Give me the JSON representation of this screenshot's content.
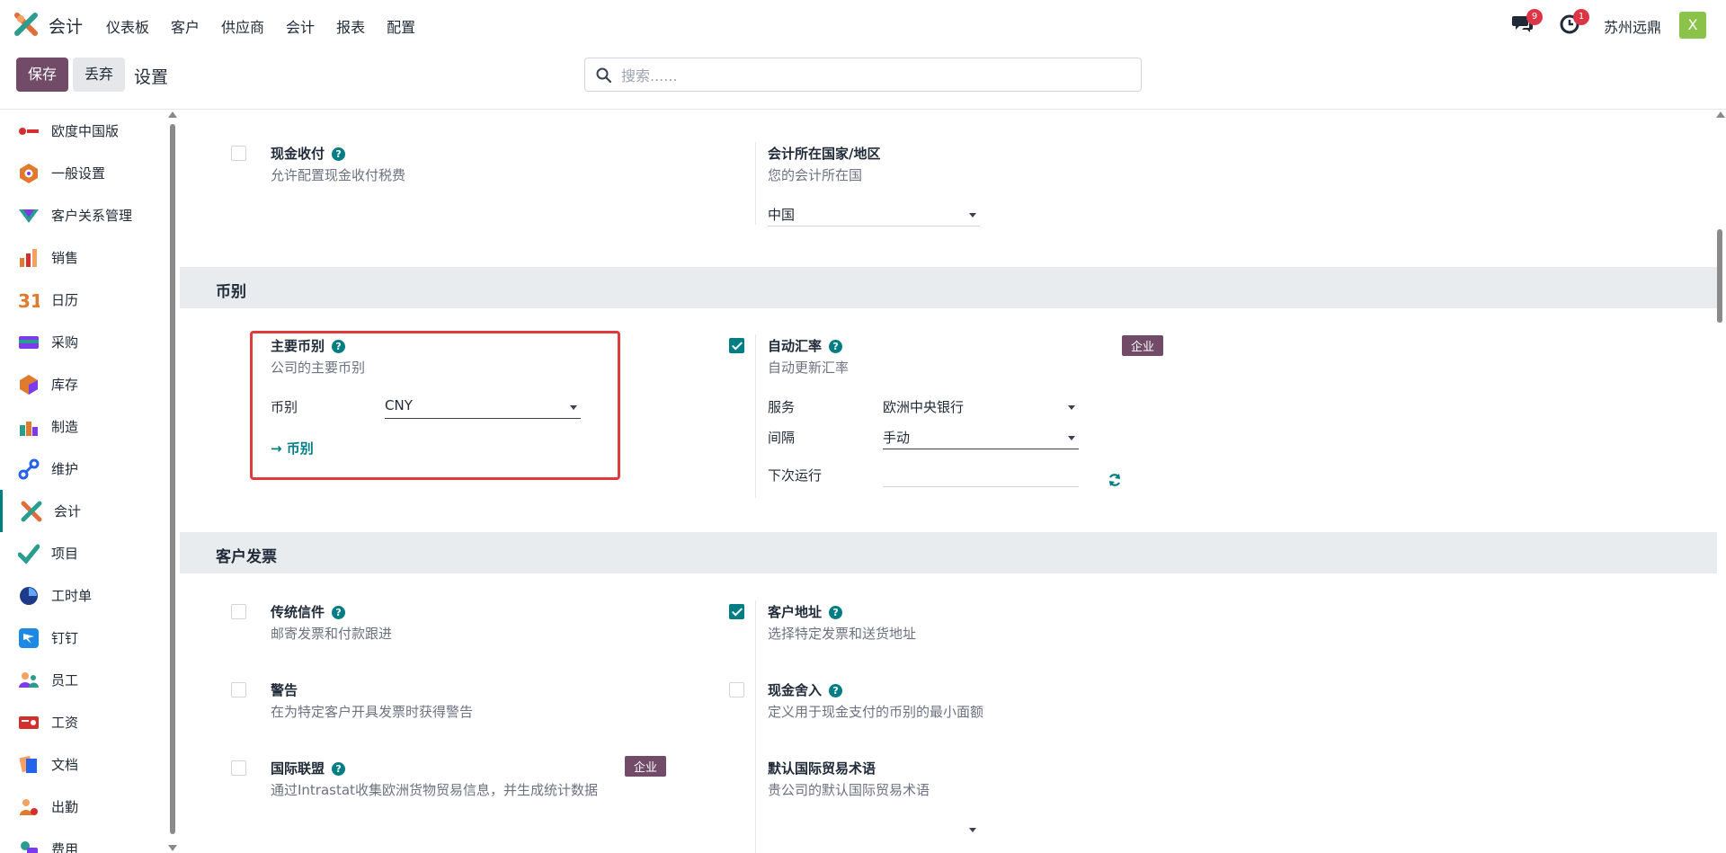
{
  "app": {
    "name": "会计"
  },
  "menu": [
    "仪表板",
    "客户",
    "供应商",
    "会计",
    "报表",
    "配置"
  ],
  "systray": {
    "messages_count": "9",
    "activities_count": "1",
    "company": "苏州远鼎",
    "avatar_letter": "X"
  },
  "control": {
    "save": "保存",
    "discard": "丢弃",
    "title": "设置",
    "search_placeholder": "搜索......"
  },
  "sidebar": {
    "items": [
      {
        "label": "欧度中国版",
        "icon": "odoo-cn-logo-icon"
      },
      {
        "label": "一般设置",
        "icon": "general-settings-icon"
      },
      {
        "label": "客户关系管理",
        "icon": "crm-icon"
      },
      {
        "label": "销售",
        "icon": "sales-icon"
      },
      {
        "label": "日历",
        "icon": "calendar-icon"
      },
      {
        "label": "采购",
        "icon": "purchase-icon"
      },
      {
        "label": "库存",
        "icon": "inventory-icon"
      },
      {
        "label": "制造",
        "icon": "manufacturing-icon"
      },
      {
        "label": "维护",
        "icon": "maintenance-icon"
      },
      {
        "label": "会计",
        "icon": "accounting-icon"
      },
      {
        "label": "项目",
        "icon": "project-icon"
      },
      {
        "label": "工时单",
        "icon": "timesheet-icon"
      },
      {
        "label": "钉钉",
        "icon": "dingtalk-icon"
      },
      {
        "label": "员工",
        "icon": "employees-icon"
      },
      {
        "label": "工资",
        "icon": "payroll-icon"
      },
      {
        "label": "文档",
        "icon": "documents-icon"
      },
      {
        "label": "出勤",
        "icon": "attendance-icon"
      },
      {
        "label": "费用",
        "icon": "expenses-icon"
      }
    ]
  },
  "tax": {
    "cash_basis": {
      "title": "现金收付",
      "desc": "允许配置现金收付税费"
    },
    "fiscal_country": {
      "title": "会计所在国家/地区",
      "desc": "您的会计所在国",
      "value": "中国"
    }
  },
  "currency": {
    "heading": "币别",
    "main": {
      "title": "主要币别",
      "desc": "公司的主要币别",
      "field_label": "币别",
      "value": "CNY",
      "link": "币别"
    },
    "auto_rate": {
      "title": "自动汇率",
      "desc": "自动更新汇率",
      "enterprise": "企业",
      "service_label": "服务",
      "service_value": "欧洲中央银行",
      "interval_label": "间隔",
      "interval_value": "手动",
      "next_run_label": "下次运行"
    }
  },
  "invoices": {
    "heading": "客户发票",
    "snailmail": {
      "title": "传统信件",
      "desc": "邮寄发票和付款跟进"
    },
    "customer_address": {
      "title": "客户地址",
      "desc": "选择特定发票和送货地址"
    },
    "warnings": {
      "title": "警告",
      "desc": "在为特定客户开具发票时获得警告"
    },
    "cash_rounding": {
      "title": "现金舍入",
      "desc": "定义用于现金支付的币别的最小面额"
    },
    "intrastat": {
      "title": "国际联盟",
      "desc": "通过Intrastat收集欧洲货物贸易信息，并生成统计数据",
      "enterprise": "企业"
    },
    "incoterm": {
      "title": "默认国际贸易术语",
      "desc": "贵公司的默认国际贸易术语"
    }
  },
  "colors": {
    "brand": "#714b67",
    "teal": "#017e84",
    "highlight": "#e03a3a"
  }
}
